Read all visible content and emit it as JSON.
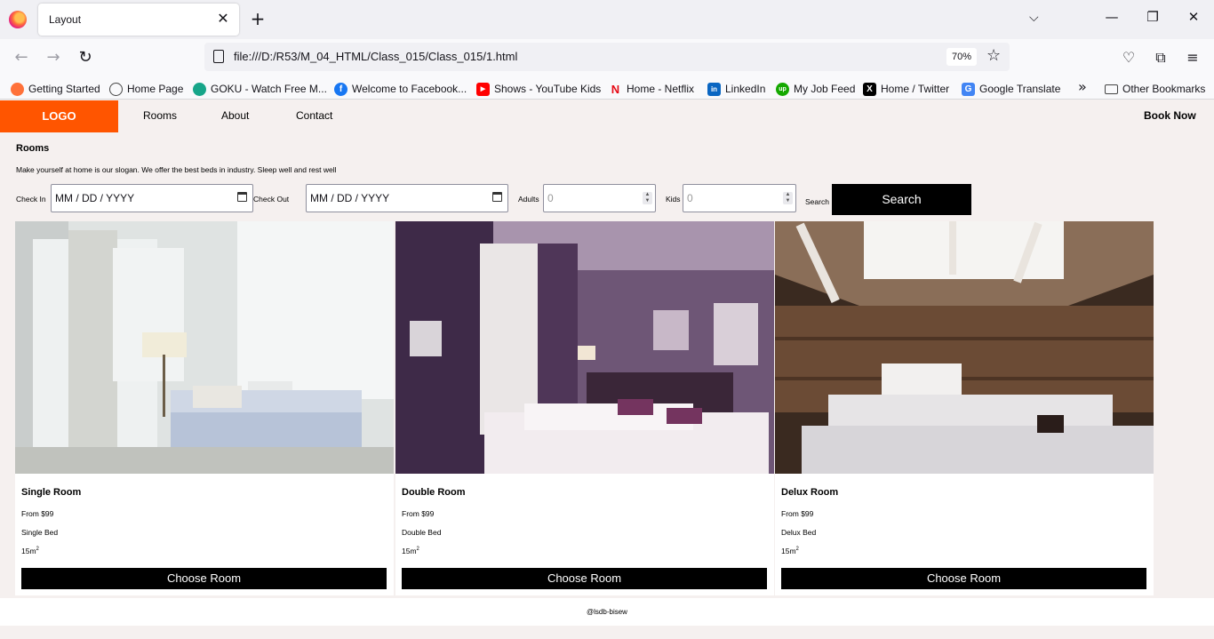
{
  "browser": {
    "tab_title": "Layout",
    "url": "file:///D:/R53/M_04_HTML/Class_015/Class_015/1.html",
    "zoom": "70%",
    "bookmarks": [
      {
        "label": "Getting Started",
        "color": "#ff7139"
      },
      {
        "label": "Home Page",
        "color": "#444444"
      },
      {
        "label": "GOKU - Watch Free M...",
        "color": "#17a589"
      },
      {
        "label": "Welcome to Facebook...",
        "color": "#1877f2"
      },
      {
        "label": "Shows - YouTube Kids",
        "color": "#ff0000"
      },
      {
        "label": "Home - Netflix",
        "color": "#e50914"
      },
      {
        "label": "LinkedIn",
        "color": "#0a66c2"
      },
      {
        "label": "My Job Feed",
        "color": "#14a800"
      },
      {
        "label": "Home / Twitter",
        "color": "#000000"
      },
      {
        "label": "Google Translate",
        "color": "#4285f4"
      }
    ],
    "other_bookmarks": "Other Bookmarks"
  },
  "site": {
    "logo": "LOGO",
    "menu": [
      "Rooms",
      "About",
      "Contact"
    ],
    "book_now": "Book Now",
    "heading": "Rooms",
    "slogan": "Make yourself at home is our slogan. We offer the best beds in industry. Sleep well and rest well",
    "form": {
      "check_in_label": "Check In",
      "check_in_value": "MM / DD / YYYY",
      "check_out_label": "Check Out",
      "check_out_value": "MM / DD / YYYY",
      "adults_label": "Adults",
      "adults_value": "0",
      "kids_label": "Kids",
      "kids_value": "0",
      "search_label": "Search",
      "search_button": "Search"
    },
    "rooms": [
      {
        "title": "Single Room",
        "price": "From $99",
        "bed": "Single Bed",
        "size": "15m",
        "size_sup": "2",
        "button": "Choose Room"
      },
      {
        "title": "Double Room",
        "price": "From $99",
        "bed": "Double Bed",
        "size": "15m",
        "size_sup": "2",
        "button": "Choose Room"
      },
      {
        "title": "Delux Room",
        "price": "From $99",
        "bed": "Delux Bed",
        "size": "15m",
        "size_sup": "2",
        "button": "Choose Room"
      }
    ],
    "footer": "@lsdb-bisew",
    "accent": "#ff5500"
  }
}
